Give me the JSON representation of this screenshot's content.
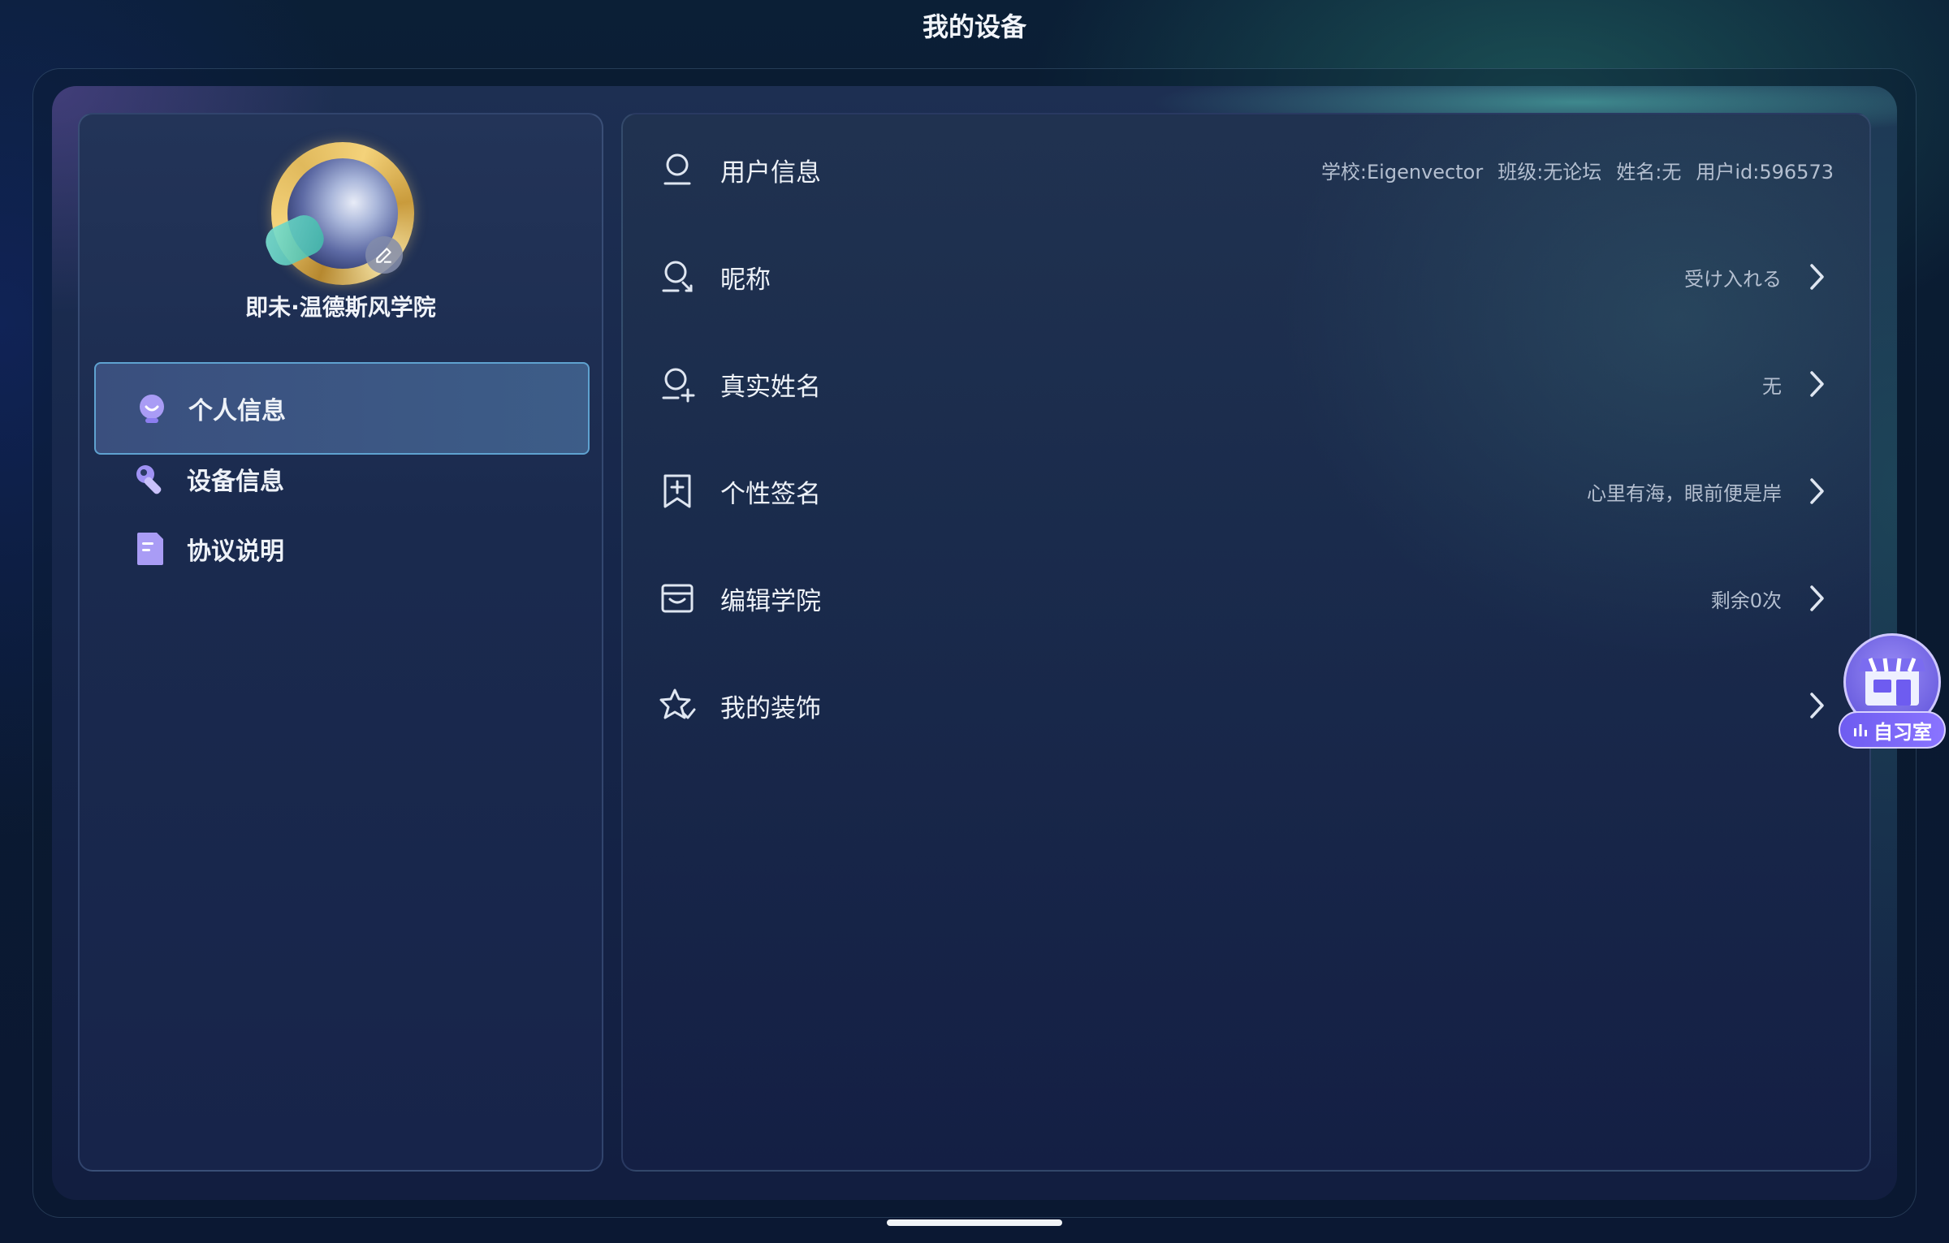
{
  "page": {
    "title": "我的设备"
  },
  "profile": {
    "username": "即未·温德斯风学院"
  },
  "sidebar": {
    "items": [
      {
        "label": "个人信息",
        "icon": "robot-face-icon",
        "active": true
      },
      {
        "label": "设备信息",
        "icon": "wrench-icon",
        "active": false
      },
      {
        "label": "协议说明",
        "icon": "document-icon",
        "active": false
      }
    ]
  },
  "settings": {
    "user_info": {
      "label": "用户信息",
      "school": "学校:Eigenvector",
      "class": "班级:无论坛",
      "name": "姓名:无",
      "user_id": "用户id:596573"
    },
    "rows": [
      {
        "label": "昵称",
        "value": "受け入れる",
        "icon": "user-edit-icon"
      },
      {
        "label": "真实姓名",
        "value": "无",
        "icon": "user-add-icon"
      },
      {
        "label": "个性签名",
        "value": "心里有海，眼前便是岸",
        "icon": "bookmark-plus-icon"
      },
      {
        "label": "编辑学院",
        "value": "剩余0次",
        "icon": "college-icon"
      },
      {
        "label": "我的装饰",
        "value": "",
        "icon": "star-decor-icon"
      }
    ]
  },
  "study_room": {
    "label": "自习室"
  },
  "colors": {
    "accent": "#5fa2d0",
    "active_bg": "#3d5d88",
    "badge": "#6e5cf0"
  }
}
